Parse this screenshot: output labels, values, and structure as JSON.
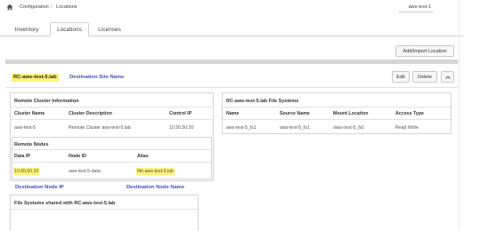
{
  "breadcrumb": {
    "home_icon": "home-icon",
    "items": [
      "Configuration",
      "Locations"
    ]
  },
  "host": "aws-test-1",
  "tabs": [
    {
      "label": "Inventory",
      "active": false
    },
    {
      "label": "Locations",
      "active": true
    },
    {
      "label": "Licenses",
      "active": false
    }
  ],
  "add_import_label": "Add/Import Location",
  "location": {
    "name": "RC-aws-test-5.lab",
    "edit_label": "Edit",
    "delete_label": "Delete",
    "collapse_icon": "chevron-up-icon"
  },
  "annotations": {
    "destination_site_name": "Destination Site Name",
    "destination_node_ip": "Destination Node IP",
    "destination_node_name": "Destination Node Name"
  },
  "remote_cluster": {
    "title": "Remote Cluster Information",
    "headers": [
      "Cluster Name",
      "Cluster Description",
      "Control IP"
    ],
    "row": [
      "aws-test-5",
      "Remote Cluster aws-test-5.lab",
      "10.50.50.20"
    ]
  },
  "remote_nodes": {
    "title": "Remote Nodes",
    "headers": [
      "Data IP",
      "Node ID",
      "Alias"
    ],
    "row": [
      "10.60.60.20",
      "aws-test-5-data",
      "fifo-aws-test-5.lab"
    ]
  },
  "file_systems": {
    "title": "RC-aws-test-5.lab File Systems",
    "headers": [
      "Name",
      "Source Name",
      "Mount Location",
      "Access Type"
    ],
    "row": [
      "aws-test-5_fs1",
      "aws-test-5_fs1",
      "/aws-test-5_fs1",
      "Read Write"
    ]
  },
  "shared": {
    "title": "File Systems shared with RC-aws-test-5.lab"
  },
  "colors": {
    "highlight": "#fff27a",
    "annotation": "#3f51b5"
  }
}
